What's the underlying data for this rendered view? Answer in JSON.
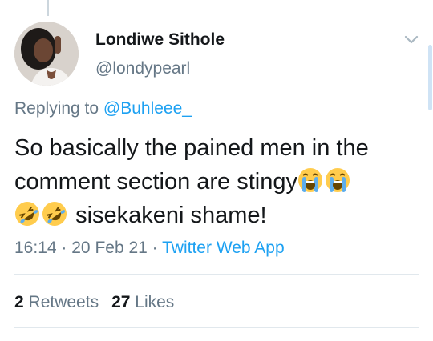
{
  "tweet": {
    "display_name": "Londiwe Sithole",
    "handle": "@londypearl",
    "replying_prefix": "Replying to",
    "replying_to": "@Buhleee_",
    "text_line1": "So basically the pained men in the",
    "text_line2": "comment section are stingy",
    "text_line3": "sisekakeni shame!",
    "emojis": [
      "loudly-crying-face",
      "loudly-crying-face",
      "rolling-on-floor-laughing",
      "rolling-on-floor-laughing"
    ],
    "time": "16:14",
    "date": "20 Feb 21",
    "separator": "·",
    "source": "Twitter Web App"
  },
  "stats": {
    "retweets_count": "2",
    "retweets_label": "Retweets",
    "likes_count": "27",
    "likes_label": "Likes"
  },
  "colors": {
    "link": "#1da1f2",
    "secondary_text": "#657786",
    "primary_text": "#14171a",
    "divider": "#e1e8ed"
  }
}
